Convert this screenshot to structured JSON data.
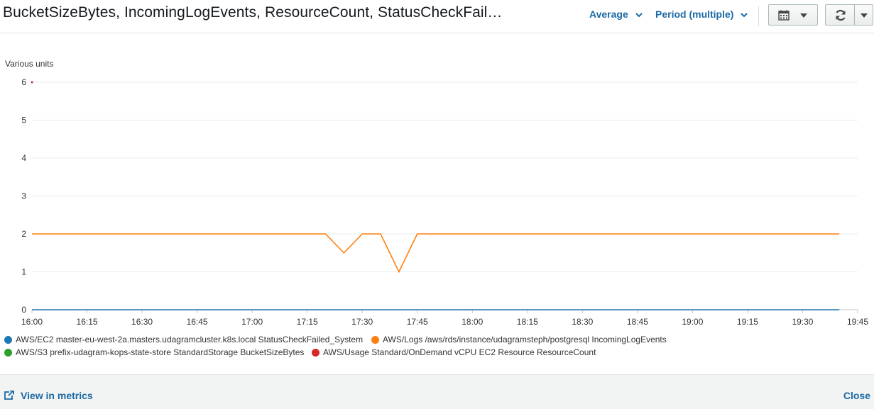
{
  "header": {
    "title": "BucketSizeBytes, IncomingLogEvents, ResourceCount, StatusCheckFail…",
    "statistic_label": "Average",
    "period_label": "Period (multiple)",
    "calendar_icon": "calendar-icon",
    "refresh_icon": "refresh-icon"
  },
  "chart_data": {
    "type": "line",
    "ylabel": "Various units",
    "ylim": [
      0,
      6
    ],
    "yticks": [
      6,
      5,
      4,
      3,
      2,
      1,
      0
    ],
    "xticks": [
      "16:00",
      "16:15",
      "16:30",
      "16:45",
      "17:00",
      "17:15",
      "17:30",
      "17:45",
      "18:00",
      "18:15",
      "18:30",
      "18:45",
      "19:00",
      "19:15",
      "19:30",
      "19:45"
    ],
    "xlim": [
      "16:00",
      "19:45"
    ],
    "grid": true,
    "legend_position": "bottom",
    "series": [
      {
        "name": "AWS/EC2 master-eu-west-2a.masters.udagramcluster.k8s.local StatusCheckFailed_System",
        "color": "#1f77b4",
        "x": [
          "16:00",
          "19:40"
        ],
        "values": [
          0,
          0
        ]
      },
      {
        "name": "AWS/Logs /aws/rds/instance/udagramsteph/postgresql IncomingLogEvents",
        "color": "#ff7f0e",
        "x": [
          "16:00",
          "17:20",
          "17:25",
          "17:30",
          "17:35",
          "17:40",
          "17:45",
          "19:40"
        ],
        "values": [
          2,
          2,
          1.5,
          2,
          2,
          1,
          2,
          2
        ]
      },
      {
        "name": "AWS/S3 prefix-udagram-kops-state-store StandardStorage BucketSizeBytes",
        "color": "#2ca02c",
        "x": [],
        "values": []
      },
      {
        "name": "AWS/Usage Standard/OnDemand vCPU EC2 Resource ResourceCount",
        "color": "#d62728",
        "x": [
          "16:00"
        ],
        "values": [
          6
        ]
      }
    ]
  },
  "footer": {
    "view_in_metrics": "View in metrics",
    "close": "Close",
    "external_link_icon": "external-link-icon"
  }
}
